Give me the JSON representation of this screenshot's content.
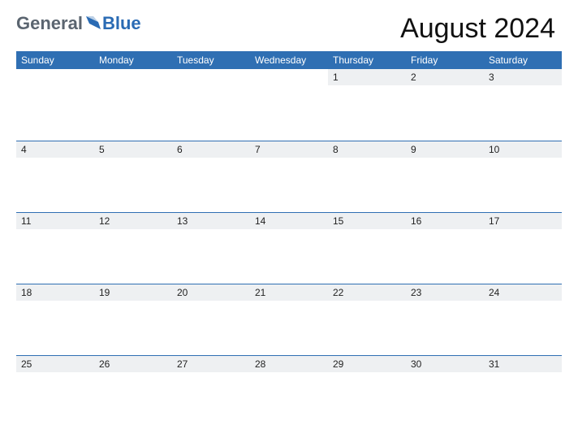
{
  "logo": {
    "word1": "General",
    "word2": "Blue"
  },
  "title": "August 2024",
  "dayHeaders": [
    "Sunday",
    "Monday",
    "Tuesday",
    "Wednesday",
    "Thursday",
    "Friday",
    "Saturday"
  ],
  "weeks": [
    [
      "",
      "",
      "",
      "",
      "1",
      "2",
      "3"
    ],
    [
      "4",
      "5",
      "6",
      "7",
      "8",
      "9",
      "10"
    ],
    [
      "11",
      "12",
      "13",
      "14",
      "15",
      "16",
      "17"
    ],
    [
      "18",
      "19",
      "20",
      "21",
      "22",
      "23",
      "24"
    ],
    [
      "25",
      "26",
      "27",
      "28",
      "29",
      "30",
      "31"
    ]
  ]
}
